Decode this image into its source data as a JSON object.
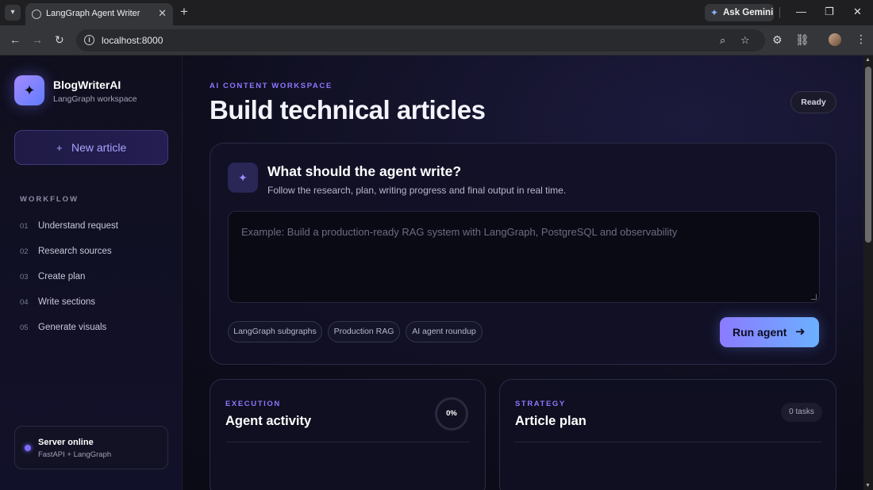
{
  "browser": {
    "tab_title": "LangGraph Agent Writer",
    "url": "localhost:8000",
    "gemini_label": "Ask Gemini"
  },
  "sidebar": {
    "brand_name": "BlogWriterAI",
    "brand_sub": "LangGraph workspace",
    "new_article_label": "New article",
    "workflow_title": "WORKFLOW",
    "steps": [
      {
        "num": "01",
        "label": "Understand request"
      },
      {
        "num": "02",
        "label": "Research sources"
      },
      {
        "num": "03",
        "label": "Create plan"
      },
      {
        "num": "04",
        "label": "Write sections"
      },
      {
        "num": "05",
        "label": "Generate visuals"
      }
    ],
    "server": {
      "title": "Server online",
      "sub": "FastAPI + LangGraph"
    }
  },
  "main": {
    "eyebrow": "AI CONTENT WORKSPACE",
    "title": "Build technical articles",
    "status": "Ready",
    "compose": {
      "title": "What should the agent write?",
      "subtitle": "Follow the research, plan, writing progress and final output in real time.",
      "placeholder": "Example: Build a production-ready RAG system with LangGraph, PostgreSQL and observability",
      "chips": [
        "LangGraph subgraphs",
        "Production RAG",
        "AI agent roundup"
      ],
      "run_label": "Run agent"
    },
    "activity": {
      "eyebrow": "EXECUTION",
      "title": "Agent activity",
      "progress": "0%"
    },
    "plan": {
      "eyebrow": "STRATEGY",
      "title": "Article plan",
      "tasks": "0 tasks"
    }
  },
  "colors": {
    "accent": "#8b78ff",
    "accent_blue": "#6bb0ff",
    "background": "#0b0b16"
  },
  "icons": {
    "brand": "sparkle-icon",
    "compose": "sparkle-icon",
    "run": "arrow-right-icon",
    "server_status": "status-dot-icon"
  }
}
